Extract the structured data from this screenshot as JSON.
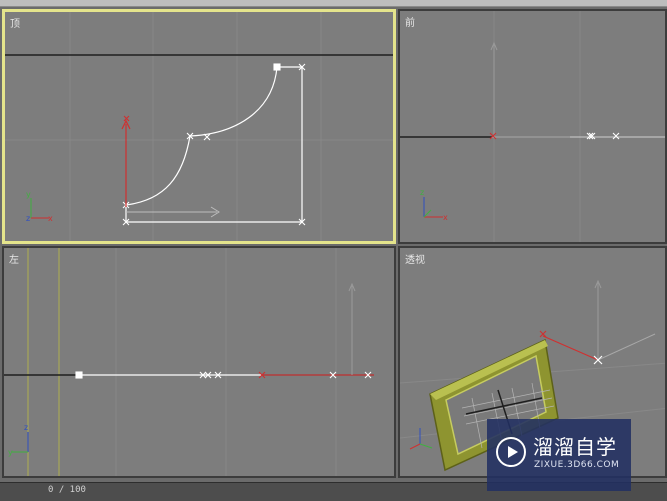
{
  "viewports": {
    "top": {
      "label": "顶"
    },
    "front": {
      "label": "前"
    },
    "left": {
      "label": "左"
    },
    "perspective": {
      "label": "透视"
    }
  },
  "axes": {
    "x": "x",
    "y": "y",
    "z": "z"
  },
  "status_bar": {
    "readout": "0 / 100"
  },
  "watermark": {
    "title": "溜溜自学",
    "url": "ZIXUE.3D66.COM"
  },
  "colors": {
    "viewport_bg": "#7d7d7d",
    "active_border": "#e4e48c",
    "spline": "#ffffff",
    "gizmo_red": "#d03030",
    "frame_green": "#9aa030"
  }
}
